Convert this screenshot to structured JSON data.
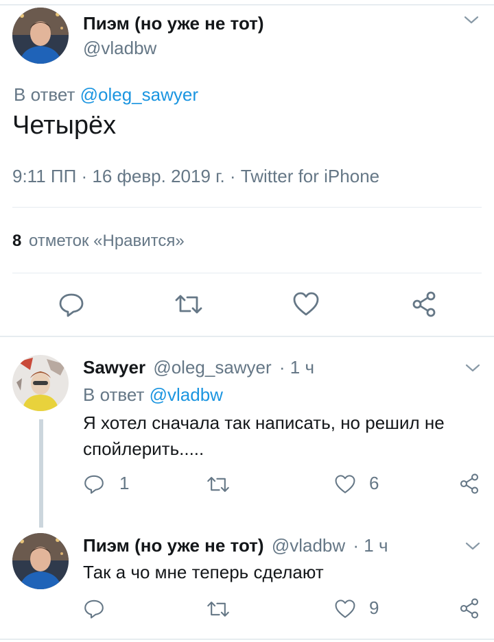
{
  "main_tweet": {
    "author_name": "Пиэм (но уже не тот)",
    "handle": "@vladbw",
    "reply_prefix": "В ответ",
    "reply_to": "@oleg_sawyer",
    "text": "Четырёх",
    "meta": "9:11 ПП · 16 февр. 2019 г. · Twitter for iPhone",
    "likes_count": "8",
    "likes_label": "отметок «Нравится»"
  },
  "replies": [
    {
      "author_name": "Sawyer",
      "handle": "@oleg_sawyer",
      "time": "· 1 ч",
      "reply_prefix": "В ответ",
      "reply_to": "@vladbw",
      "text_line1": "Я хотел сначала так написать, но решил не",
      "text_line2": "спойлерить.....",
      "reply_count": "1",
      "retweet_count": "",
      "like_count": "6"
    },
    {
      "author_name": "Пиэм (но уже не тот)",
      "handle": "@vladbw",
      "time": "· 1 ч",
      "text": "Так а чо мне теперь сделают",
      "reply_count": "",
      "retweet_count": "",
      "like_count": "9"
    }
  ],
  "icons": {
    "reply": "reply-icon",
    "retweet": "retweet-icon",
    "like": "heart-icon",
    "share": "share-icon",
    "menu": "chevron-down-icon"
  },
  "colors": {
    "link": "#1b95e0",
    "secondary": "#657786",
    "divider": "#e6ecf0"
  }
}
